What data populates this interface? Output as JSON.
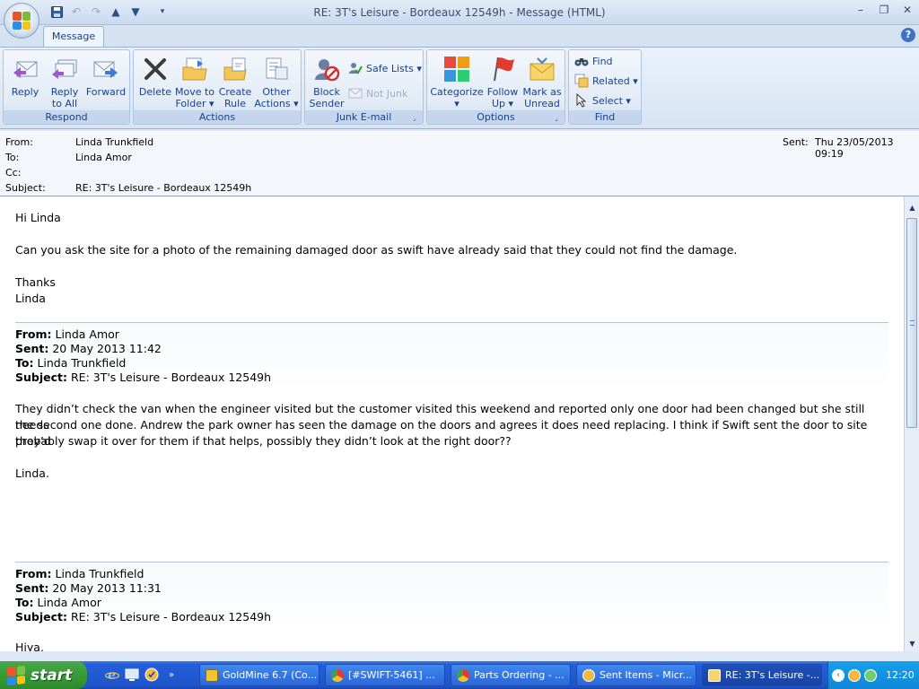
{
  "window": {
    "title": "RE: 3T's Leisure - Bordeaux 12549h - Message (HTML)",
    "controls": {
      "minimize": "–",
      "restore": "❐",
      "close": "✕"
    }
  },
  "ribbon": {
    "tab": "Message",
    "help": "?",
    "groups": {
      "respond": {
        "label": "Respond",
        "reply": {
          "line1": "Reply",
          "line2": ""
        },
        "reply_all": {
          "line1": "Reply",
          "line2": "to All"
        },
        "forward": {
          "line1": "Forward",
          "line2": ""
        }
      },
      "actions": {
        "label": "Actions",
        "delete": {
          "line1": "Delete",
          "line2": ""
        },
        "move": {
          "line1": "Move to",
          "line2": "Folder ▾"
        },
        "create_rule": {
          "line1": "Create",
          "line2": "Rule"
        },
        "other": {
          "line1": "Other",
          "line2": "Actions ▾"
        }
      },
      "junk": {
        "label": "Junk E-mail",
        "block": {
          "line1": "Block",
          "line2": "Sender"
        },
        "safe_lists": "Safe Lists ▾",
        "not_junk": "Not Junk"
      },
      "options": {
        "label": "Options",
        "categorize": {
          "line1": "Categorize",
          "line2": "▾"
        },
        "follow_up": {
          "line1": "Follow",
          "line2": "Up ▾"
        },
        "mark_unread": {
          "line1": "Mark as",
          "line2": "Unread"
        }
      },
      "find": {
        "label": "Find",
        "find": "Find",
        "related": "Related ▾",
        "select": "Select ▾"
      }
    }
  },
  "header": {
    "from_label": "From:",
    "from": "Linda Trunkfield",
    "to_label": "To:",
    "to": "Linda Amor",
    "cc_label": "Cc:",
    "cc": "",
    "subject_label": "Subject:",
    "subject": "RE: 3T's Leisure - Bordeaux 12549h",
    "sent_label": "Sent:",
    "sent": "Thu 23/05/2013 09:19"
  },
  "body": {
    "greeting": "Hi Linda",
    "para1": "Can you ask the site for a photo of the remaining damaged door as swift have already said that they could not find the damage.",
    "thanks": "Thanks",
    "sign": "Linda",
    "quote1": {
      "from_label": "From:",
      "from": "Linda Amor",
      "sent_label": "Sent:",
      "sent": "20 May 2013 11:42",
      "to_label": "To:",
      "to": "Linda Trunkfield",
      "subject_label": "Subject:",
      "subject": "RE: 3T's Leisure - Bordeaux 12549h",
      "line1": "They didn’t check the van when the engineer visited but the customer visited this weekend and reported only one door had been changed but she still needs",
      "line2": "the second one done. Andrew the park owner has seen the damage on the doors and agrees it does need replacing.  I think if Swift sent the door to site they’d",
      "line3": "probably swap it over for them if that helps, possibly they didn’t look at the right door??",
      "sign": "Linda."
    },
    "quote2": {
      "from_label": "From:",
      "from": "Linda Trunkfield",
      "sent_label": "Sent:",
      "sent": "20 May 2013 11:31",
      "to_label": "To:",
      "to": "Linda Amor",
      "subject_label": "Subject:",
      "subject": "RE: 3T's Leisure - Bordeaux 12549h",
      "greeting": "Hiya,"
    }
  },
  "taskbar": {
    "start": "start",
    "tasks": [
      "GoldMine 6.7 (Co...",
      "[#SWIFT-5461] ...",
      "Parts Ordering - ...",
      "Sent Items - Micr...",
      "RE: 3T's Leisure -..."
    ],
    "clock": "12:20"
  }
}
